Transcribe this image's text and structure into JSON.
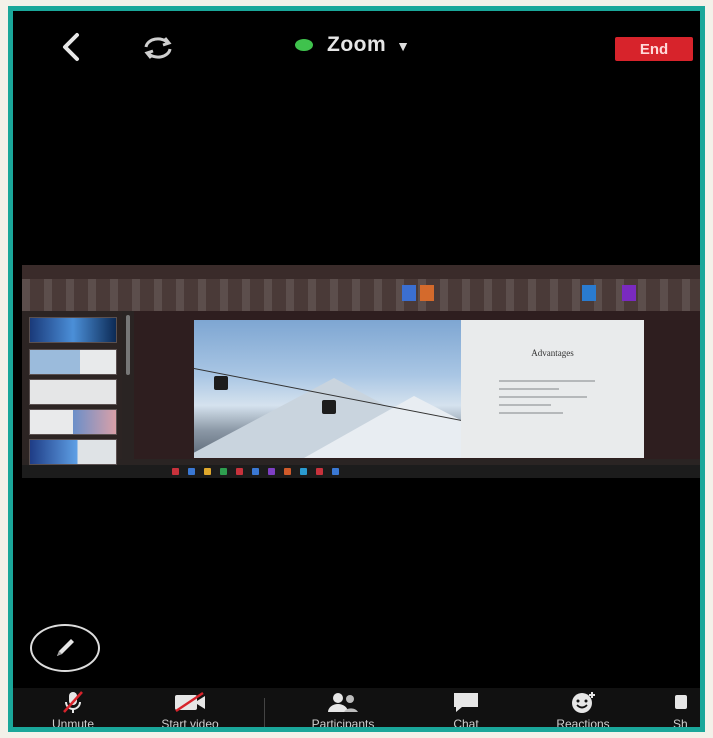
{
  "header": {
    "meeting_title": "Zoom",
    "end_label": "End"
  },
  "shared_slide": {
    "heading": "Advantages"
  },
  "toolbar": {
    "items": [
      {
        "label": "Unmute",
        "icon": "microphone-muted-icon"
      },
      {
        "label": "Start video",
        "icon": "video-off-icon"
      },
      {
        "label": "Participants",
        "icon": "participants-icon"
      },
      {
        "label": "Chat",
        "icon": "chat-icon"
      },
      {
        "label": "Reactions",
        "icon": "reactions-icon"
      },
      {
        "label": "Sh",
        "icon": "share-icon"
      }
    ]
  },
  "colors": {
    "frame_border": "#1aa79a",
    "end_button": "#d7232b",
    "status_dot": "#3fc24d"
  }
}
